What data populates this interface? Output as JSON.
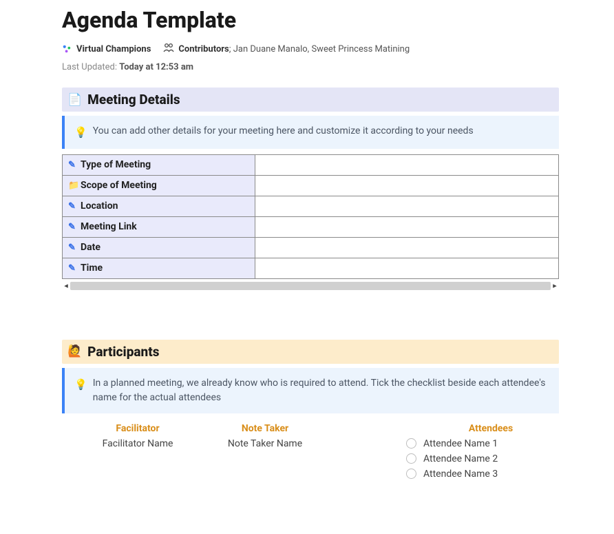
{
  "title": "Agenda Template",
  "workspace": "Virtual Champions",
  "contributors_label": "Contributors",
  "contributors_names": "Jan Duane Manalo, Sweet Princess Matining",
  "last_updated_label": "Last Updated:",
  "last_updated_value": "Today at 12:53 am",
  "sections": {
    "meeting_details": {
      "title": "Meeting Details",
      "tip": "You can add other details for your meeting here and customize it according to your needs",
      "rows": [
        {
          "icon": "pen",
          "label": "Type of Meeting",
          "value": ""
        },
        {
          "icon": "folder",
          "label": "Scope of Meeting",
          "value": ""
        },
        {
          "icon": "pen",
          "label": "Location",
          "value": ""
        },
        {
          "icon": "pen",
          "label": "Meeting Link",
          "value": ""
        },
        {
          "icon": "pen",
          "label": "Date",
          "value": ""
        },
        {
          "icon": "pen",
          "label": "Time",
          "value": ""
        }
      ]
    },
    "participants": {
      "title": "Participants",
      "tip": "In a planned meeting, we already know who is required to attend. Tick the checklist beside each attendee's name for the actual attendees",
      "facilitator_header": "Facilitator",
      "facilitator_value": "Facilitator Name",
      "note_taker_header": "Note Taker",
      "note_taker_value": "Note Taker Name",
      "attendees_header": "Attendees",
      "attendees": [
        "Attendee Name 1",
        "Attendee Name 2",
        "Attendee Name 3"
      ]
    }
  }
}
